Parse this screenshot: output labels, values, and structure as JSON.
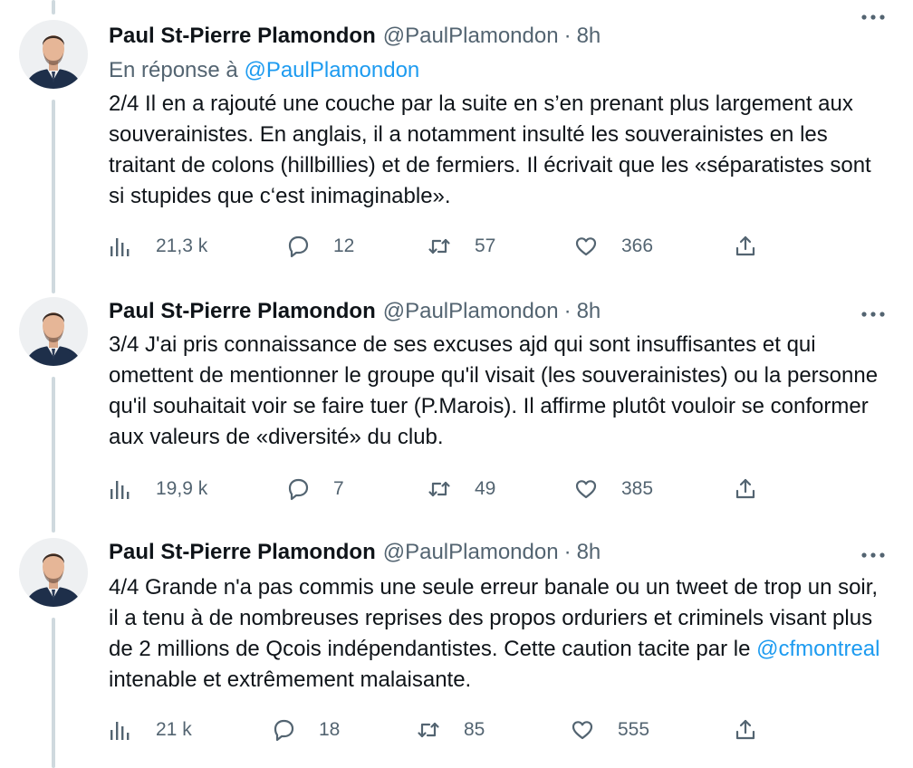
{
  "tweets": [
    {
      "name": "Paul St-Pierre Plamondon",
      "handle": "@PaulPlamondon",
      "separator": "·",
      "time": "8h",
      "reply_prefix": "En réponse à",
      "reply_handle": "@PaulPlamondon",
      "text": "2/4 Il en a rajouté une couche par la suite en s’en prenant plus largement aux souverainistes. En anglais, il a notamment insulté les souverainistes en les traitant de colons (hillbillies) et de fermiers. Il écrivait que les «séparatistes sont si stupides que c‘est inimaginable».",
      "views": "21,3 k",
      "replies": "12",
      "retweets": "57",
      "likes": "366"
    },
    {
      "name": "Paul St-Pierre Plamondon",
      "handle": "@PaulPlamondon",
      "separator": "·",
      "time": "8h",
      "text": "3/4 J'ai pris connaissance de ses excuses ajd qui sont insuffisantes et qui omettent de mentionner le groupe qu'il visait (les souverainistes) ou la personne qu'il souhaitait voir se faire tuer (P.Marois). Il affirme plutôt vouloir se conformer aux valeurs de «diversité» du club.",
      "views": "19,9 k",
      "replies": "7",
      "retweets": "49",
      "likes": "385"
    },
    {
      "name": "Paul St-Pierre Plamondon",
      "handle": "@PaulPlamondon",
      "separator": "·",
      "time": "8h",
      "text_before_mention": "4/4 Grande n'a pas commis une seule erreur banale ou un tweet de trop un soir, il a tenu à de nombreuses reprises des propos orduriers et criminels visant plus de 2 millions de Qcois indépendantistes. Cette caution tacite par le ",
      "mention": "@cfmontreal",
      "text_after_mention": " intenable et extrêmement malaisante.",
      "views": "21 k",
      "replies": "18",
      "retweets": "85",
      "likes": "555"
    }
  ],
  "icons": {
    "views": "bar-chart-icon",
    "reply": "speech-bubble-icon",
    "retweet": "retweet-icon",
    "like": "heart-icon",
    "share": "share-icon",
    "more": "more-dots-icon"
  },
  "colors": {
    "link": "#1d9bf0",
    "secondary": "#536471",
    "text": "#0f1419",
    "thread_line": "#cfd9de"
  }
}
